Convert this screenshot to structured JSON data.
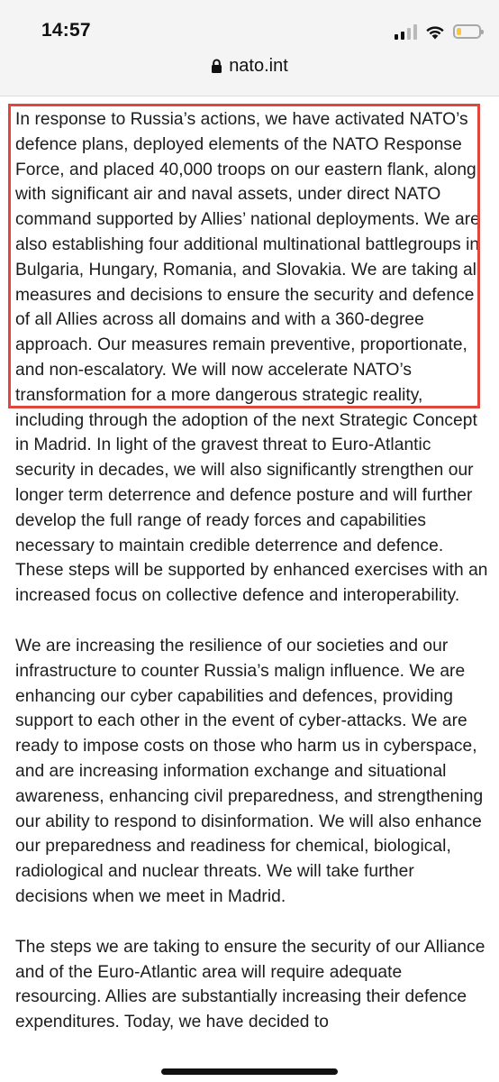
{
  "status_bar": {
    "time": "14:57",
    "signal": "signal-bars-icon",
    "wifi": "wifi-icon",
    "battery": "battery-low-icon",
    "battery_level": 0.2,
    "battery_color": "#f7c740"
  },
  "browser": {
    "url": "nato.int",
    "lock": "lock-icon"
  },
  "highlight": {
    "color": "#e0463d",
    "text": "In response to Russia’s actions, we have activated NATO’s defence plans, deployed elements of the NATO Response Force, and placed 40,000 troops on our eastern flank, along with significant air and naval assets, under direct NATO command supported by Allies’ national deployments. We are also establishing four additional multinational battlegroups in Bulgaria, Hungary, Romania, and Slovakia. We are taking all measures and decisions to ensure the security and defence of all Allies across all domains and with a 360-degree approach.  Our measures remain preventive, proportionate, and non-escalatory."
  },
  "article": {
    "paragraph_1_rest": " We will now accelerate NATO’s transformation for a more dangerous strategic reality, including through the adoption of the next Strategic Concept in Madrid. In light of the gravest threat to Euro-Atlantic security in decades, we will also significantly strengthen our longer term deterrence and defence posture and will further develop the full range of ready forces and capabilities necessary to maintain credible deterrence and defence. These steps will be supported by enhanced exercises with an increased focus on collective defence and interoperability.",
    "paragraph_2": "We are increasing the resilience of our societies and our infrastructure to counter Russia’s malign influence. We are enhancing our cyber capabilities and defences, providing support to each other in the event of cyber-attacks. We are ready to impose costs on those who harm us in cyberspace, and are increasing information exchange and situational awareness, enhancing civil preparedness, and strengthening our ability to respond to disinformation. We will also enhance our preparedness and readiness for chemical, biological, radiological and nuclear threats. We will take further decisions when we meet in Madrid.",
    "paragraph_3": "The steps we are taking to ensure the security of our Alliance and of the Euro-Atlantic area will require adequate resourcing.  Allies are substantially increasing their defence expenditures. Today, we have decided to"
  }
}
